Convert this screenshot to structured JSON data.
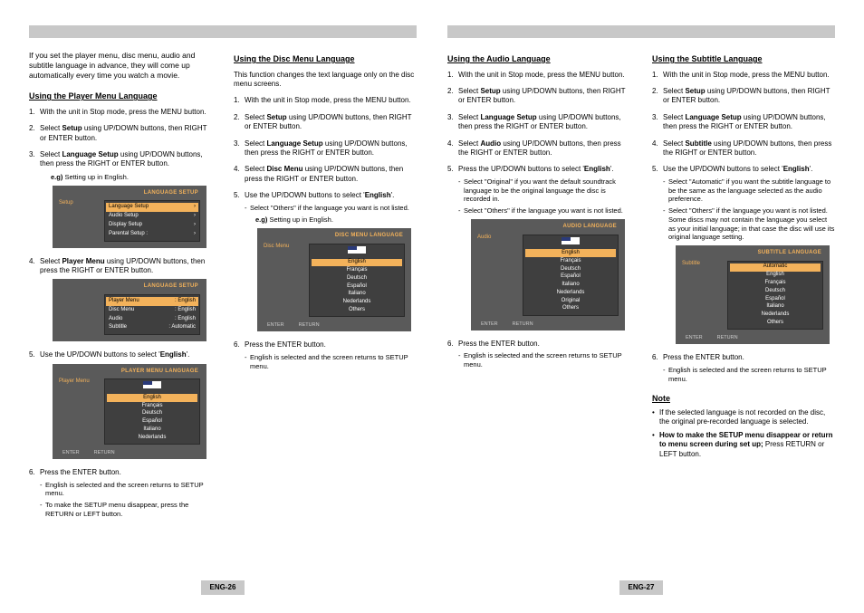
{
  "page_left": {
    "number": "ENG-26"
  },
  "page_right": {
    "number": "ENG-27"
  },
  "intro": "If you set the player menu, disc menu, audio and subtitle language in advance, they will come up automatically every time you watch a movie.",
  "player_menu": {
    "heading": "Using the Player Menu Language",
    "s1": "With the unit in Stop mode, press the MENU button.",
    "s2a": "Select ",
    "s2b": "Setup",
    "s2c": " using UP/DOWN buttons, then RIGHT or ENTER button.",
    "s3a": "Select ",
    "s3b": "Language Setup",
    "s3c": " using UP/DOWN buttons, then press the RIGHT or ENTER button.",
    "eg": "Setting up in English.",
    "s4a": "Select ",
    "s4b": "Player Menu",
    "s4c": " using UP/DOWN buttons, then press the RIGHT or ENTER button.",
    "s5a": "Use the UP/DOWN buttons to select '",
    "s5b": "English",
    "s5c": "'.",
    "s6": "Press the ENTER button.",
    "s6sub1": "English is selected and the screen returns to SETUP menu.",
    "s6sub2": "To make the SETUP menu disappear, press the RETURN or LEFT button."
  },
  "disc_menu": {
    "heading": "Using the Disc Menu Language",
    "intro": "This function changes the text language only on the disc menu screens.",
    "s1": "With the unit in Stop mode, press the MENU button.",
    "s2a": "Select ",
    "s2b": "Setup",
    "s2c": " using UP/DOWN buttons, then RIGHT or ENTER button.",
    "s3a": "Select ",
    "s3b": "Language Setup",
    "s3c": " using UP/DOWN buttons, then press the RIGHT or ENTER button.",
    "s4a": "Select ",
    "s4b": "Disc Menu",
    "s4c": " using UP/DOWN buttons, then press the RIGHT or ENTER button.",
    "s5a": "Use the UP/DOWN buttons to select '",
    "s5b": "English",
    "s5c": "'.",
    "s5sub": "Select \"Others\" if the language you want is not listed.",
    "eg": "Setting up in English.",
    "s6": "Press the ENTER button.",
    "s6sub": "English is selected and the screen returns to SETUP menu."
  },
  "audio": {
    "heading": "Using the Audio Language",
    "s1": "With the unit in Stop mode, press the MENU button.",
    "s2a": "Select ",
    "s2b": "Setup",
    "s2c": " using UP/DOWN buttons, then RIGHT or ENTER button.",
    "s3a": "Select ",
    "s3b": "Language Setup",
    "s3c": " using UP/DOWN buttons, then press the RIGHT or ENTER button.",
    "s4a": "Select ",
    "s4b": "Audio",
    "s4c": " using UP/DOWN buttons, then press the RIGHT or ENTER button.",
    "s5a": "Press the UP/DOWN buttons to select '",
    "s5b": "English",
    "s5c": "'.",
    "s5sub1": "Select \"Original\" if you want the default soundtrack language to be the original language the disc is recorded in.",
    "s5sub2": "Select \"Others\" if the language you want is not listed.",
    "s6": "Press the ENTER button.",
    "s6sub": "English is selected and the screen returns to SETUP menu."
  },
  "subtitle": {
    "heading": "Using the Subtitle Language",
    "s1": "With the unit in Stop mode, press the MENU button.",
    "s2a": "Select ",
    "s2b": "Setup",
    "s2c": " using UP/DOWN buttons, then RIGHT or ENTER button.",
    "s3a": "Select ",
    "s3b": "Language Setup",
    "s3c": " using UP/DOWN buttons, then press the RIGHT or ENTER button.",
    "s4a": "Select ",
    "s4b": "Subtitle",
    "s4c": " using UP/DOWN buttons, then press the RIGHT or ENTER button.",
    "s5a": "Use the UP/DOWN buttons to select '",
    "s5b": "English",
    "s5c": "'.",
    "s5sub1": "Select \"Automatic\" if you want the subtitle language to be the same as the language selected as the audio preference.",
    "s5sub2": "Select \"Others\" if the language you want is not listed. Some discs may not contain the language you select as your initial language; in that case the disc will use its original language setting.",
    "s6": "Press the ENTER button.",
    "s6sub": "English is selected and the screen returns to SETUP menu."
  },
  "note": {
    "heading": "Note",
    "n1": "If the selected language is not recorded on the disc, the original pre-recorded language is selected.",
    "n2a": "How to make the SETUP menu disappear or return to menu screen during set up;",
    "n2b": " Press RETURN or LEFT button."
  },
  "osd": {
    "langsetup_title": "LANGUAGE SETUP",
    "sidebar_setup": "Setup",
    "row_lang": "Language Setup",
    "row_audio_setup": "Audio Setup",
    "row_display": "Display Setup",
    "row_parental": "Parental Setup :",
    "playermenu_title": "LANGUAGE SETUP",
    "pm_row1": "Player Menu",
    "pm_row1v": ": English",
    "pm_row2": "Disc Menu",
    "pm_row2v": ": English",
    "pm_row3": "Audio",
    "pm_row3v": ": English",
    "pm_row4": "Subtitle",
    "pm_row4v": ": Automatic",
    "pml_title": "PLAYER MENU LANGUAGE",
    "pml_left": "Player Menu",
    "dml_title": "DISC MENU LANGUAGE",
    "dml_left": "Disc Menu",
    "al_title": "AUDIO LANGUAGE",
    "al_left": "Audio",
    "sl_title": "SUBTITLE LANGUAGE",
    "sl_left": "Subtitle",
    "lang_en": "English",
    "lang_fr": "Français",
    "lang_de": "Deutsch",
    "lang_es": "Español",
    "lang_it": "Italiano",
    "lang_nl": "Nederlands",
    "lang_orig": "Original",
    "lang_auto": "Automatic",
    "lang_oth": "Others",
    "f_enter": "ENTER",
    "f_return": "RETURN"
  }
}
